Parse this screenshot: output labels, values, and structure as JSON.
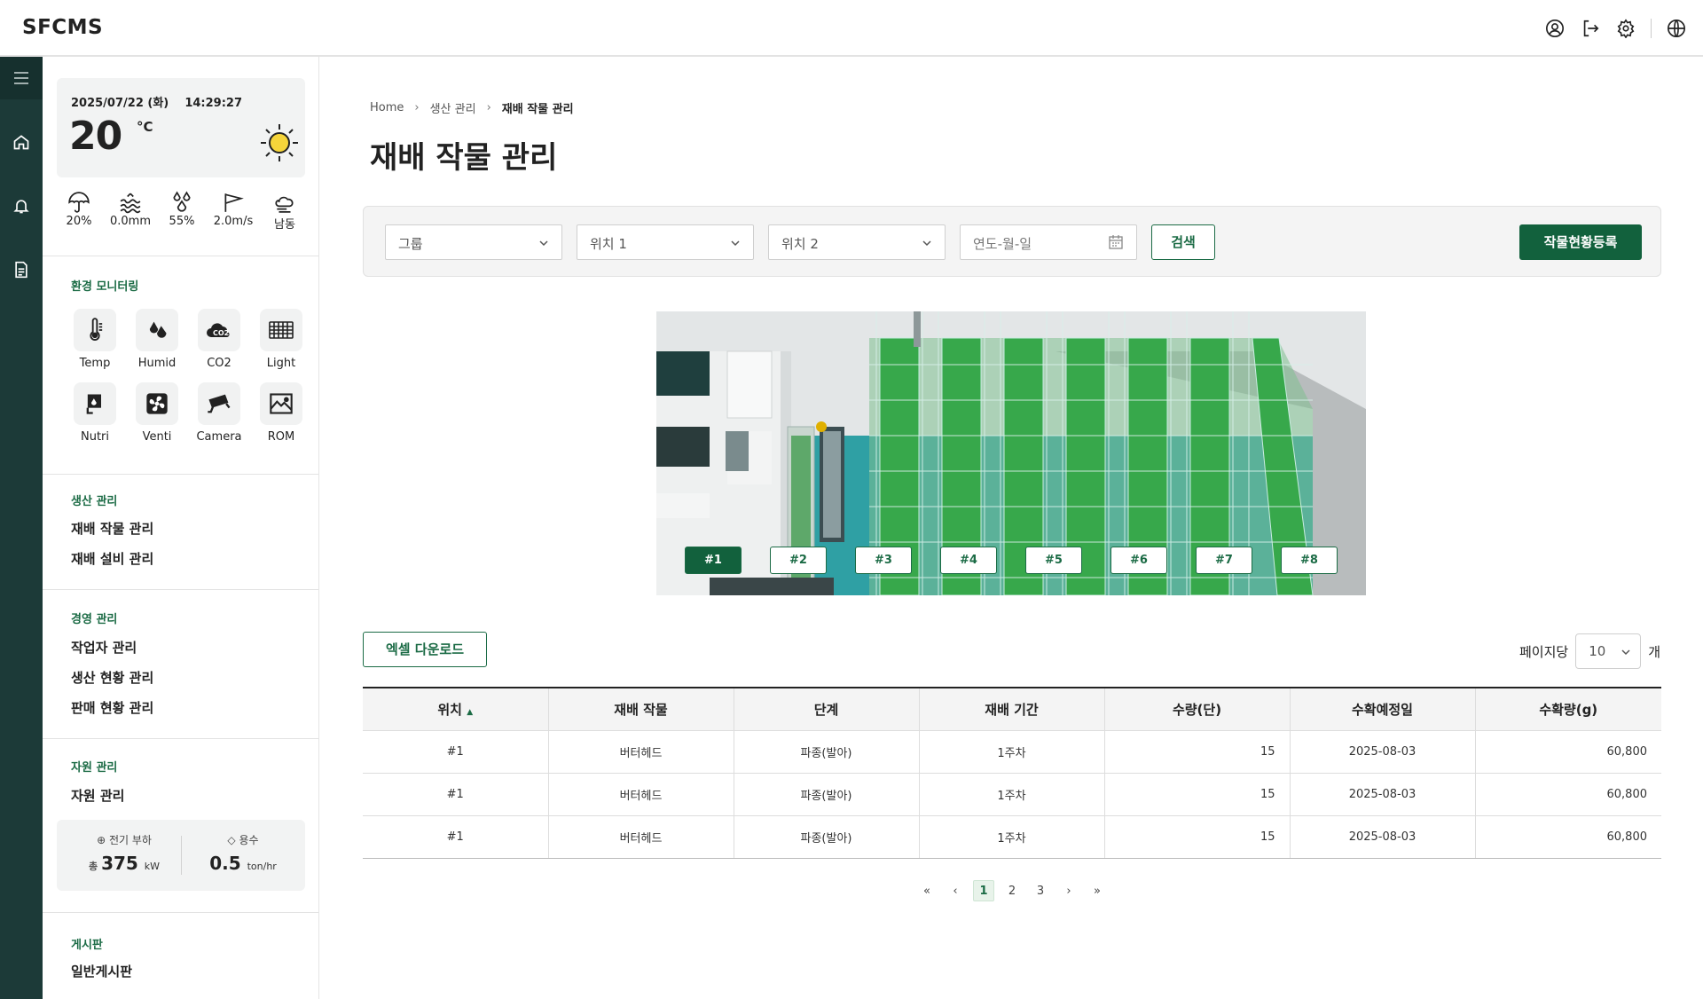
{
  "app": {
    "logo": "SFCMS"
  },
  "weather": {
    "datetime": "2025/07/22 (화)    14:29:27",
    "temp": "20",
    "unit": "°C",
    "stats": [
      {
        "icon": "umbrella-icon",
        "value": "20%"
      },
      {
        "icon": "rain-waves-icon",
        "value": "0.0mm"
      },
      {
        "icon": "humidity-drops-icon",
        "value": "55%"
      },
      {
        "icon": "wind-flag-icon",
        "value": "2.0m/s"
      },
      {
        "icon": "wind-direction-icon",
        "value": "남동"
      }
    ]
  },
  "monitoring": {
    "title": "환경 모니터링",
    "items": [
      {
        "label": "Temp",
        "icon": "thermometer-icon"
      },
      {
        "label": "Humid",
        "icon": "humidity-icon"
      },
      {
        "label": "CO2",
        "icon": "co2-icon"
      },
      {
        "label": "Light",
        "icon": "light-panel-icon"
      },
      {
        "label": "Nutri",
        "icon": "nutrient-icon"
      },
      {
        "label": "Venti",
        "icon": "fan-icon"
      },
      {
        "label": "Camera",
        "icon": "camera-icon"
      },
      {
        "label": "ROM",
        "icon": "chart-icon"
      }
    ]
  },
  "nav": {
    "production": {
      "title": "생산 관리",
      "items": [
        "재배 작물 관리",
        "재배 설비 관리"
      ]
    },
    "management": {
      "title": "경영 관리",
      "items": [
        "작업자 관리",
        "생산 현황 관리",
        "판매 현황 관리"
      ]
    },
    "resource": {
      "title": "자원 관리",
      "items": [
        "자원 관리"
      ]
    },
    "board": {
      "title": "게시판",
      "items": [
        "일반게시판"
      ]
    }
  },
  "resources": {
    "power": {
      "label": "전기 부하",
      "prefix": "총",
      "value": "375",
      "unit": "kW"
    },
    "water": {
      "label": "용수",
      "value": "0.5",
      "unit": "ton/hr"
    }
  },
  "breadcrumb": [
    "Home",
    "생산 관리",
    "재배 작물 관리"
  ],
  "page_title": "재배 작물 관리",
  "filters": {
    "group": "그룹",
    "loc1": "위치 1",
    "loc2": "위치 2",
    "date_placeholder": "연도-월-일",
    "search": "검색",
    "register": "작물현황등록"
  },
  "positions": [
    "#1",
    "#2",
    "#3",
    "#4",
    "#5",
    "#6",
    "#7",
    "#8"
  ],
  "active_position": "#1",
  "excel": "엑셀 다운로드",
  "perpage": {
    "label": "페이지당",
    "value": "10",
    "suffix": "개"
  },
  "table": {
    "headers": [
      "위치",
      "재배 작물",
      "단계",
      "재배 기간",
      "수량(단)",
      "수확예정일",
      "수확량(g)"
    ],
    "rows": [
      [
        "#1",
        "버터헤드",
        "파종(발아)",
        "1주차",
        "15",
        "2025-08-03",
        "60,800"
      ],
      [
        "#1",
        "버터헤드",
        "파종(발아)",
        "1주차",
        "15",
        "2025-08-03",
        "60,800"
      ],
      [
        "#1",
        "버터헤드",
        "파종(발아)",
        "1주차",
        "15",
        "2025-08-03",
        "60,800"
      ]
    ]
  },
  "pagination": {
    "pages": [
      "1",
      "2",
      "3"
    ],
    "current": "1"
  },
  "colors": {
    "accent": "#12613d",
    "rail": "#1c3a38"
  }
}
